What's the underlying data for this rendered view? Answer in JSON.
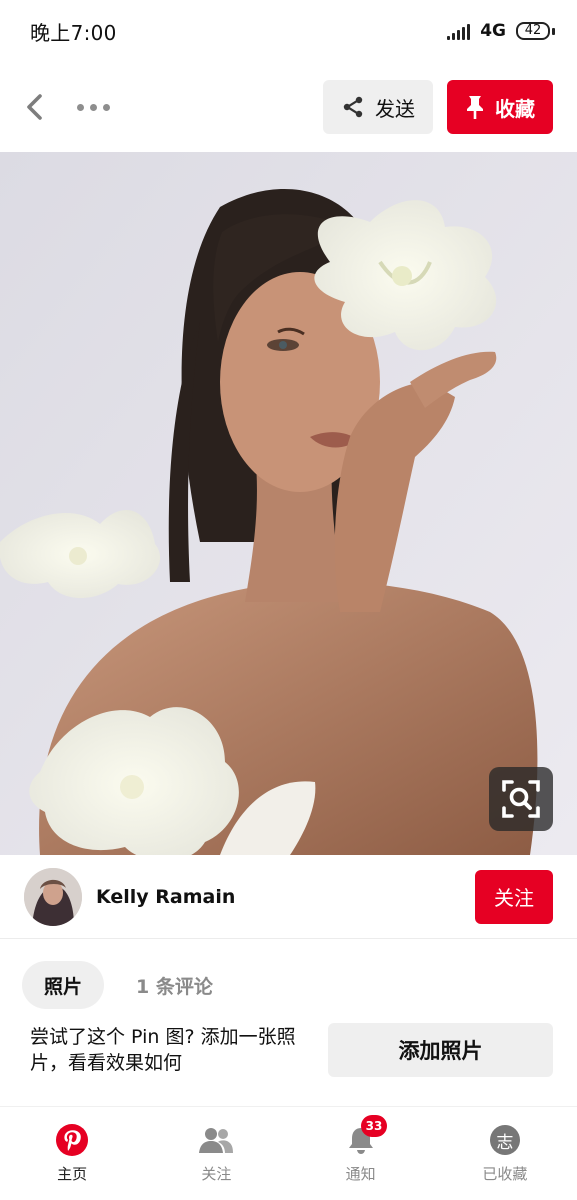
{
  "status_bar": {
    "time": "晚上7:00",
    "network": "4G",
    "battery": "42"
  },
  "topbar": {
    "send_label": "发送",
    "save_label": "收藏"
  },
  "creator": {
    "name": "Kelly Ramain",
    "follow_label": "关注"
  },
  "tabs": [
    {
      "label": "照片",
      "active": true
    },
    {
      "label": "1 条评论",
      "active": false
    }
  ],
  "try": {
    "text": "尝试了这个 Pin 图? 添加一张照片，看看效果如何",
    "button": "添加照片"
  },
  "bottom_nav": {
    "items": [
      {
        "label": "主页",
        "icon": "pinterest-logo-icon",
        "active": true
      },
      {
        "label": "关注",
        "icon": "people-icon",
        "active": false
      },
      {
        "label": "通知",
        "icon": "bell-icon",
        "active": false,
        "badge": "33"
      },
      {
        "label": "已收藏",
        "icon": "saved-profile-icon",
        "active": false,
        "avatar_char": "志"
      }
    ]
  },
  "colors": {
    "brand": "#E60023",
    "light_button": "#EFEFEF"
  }
}
